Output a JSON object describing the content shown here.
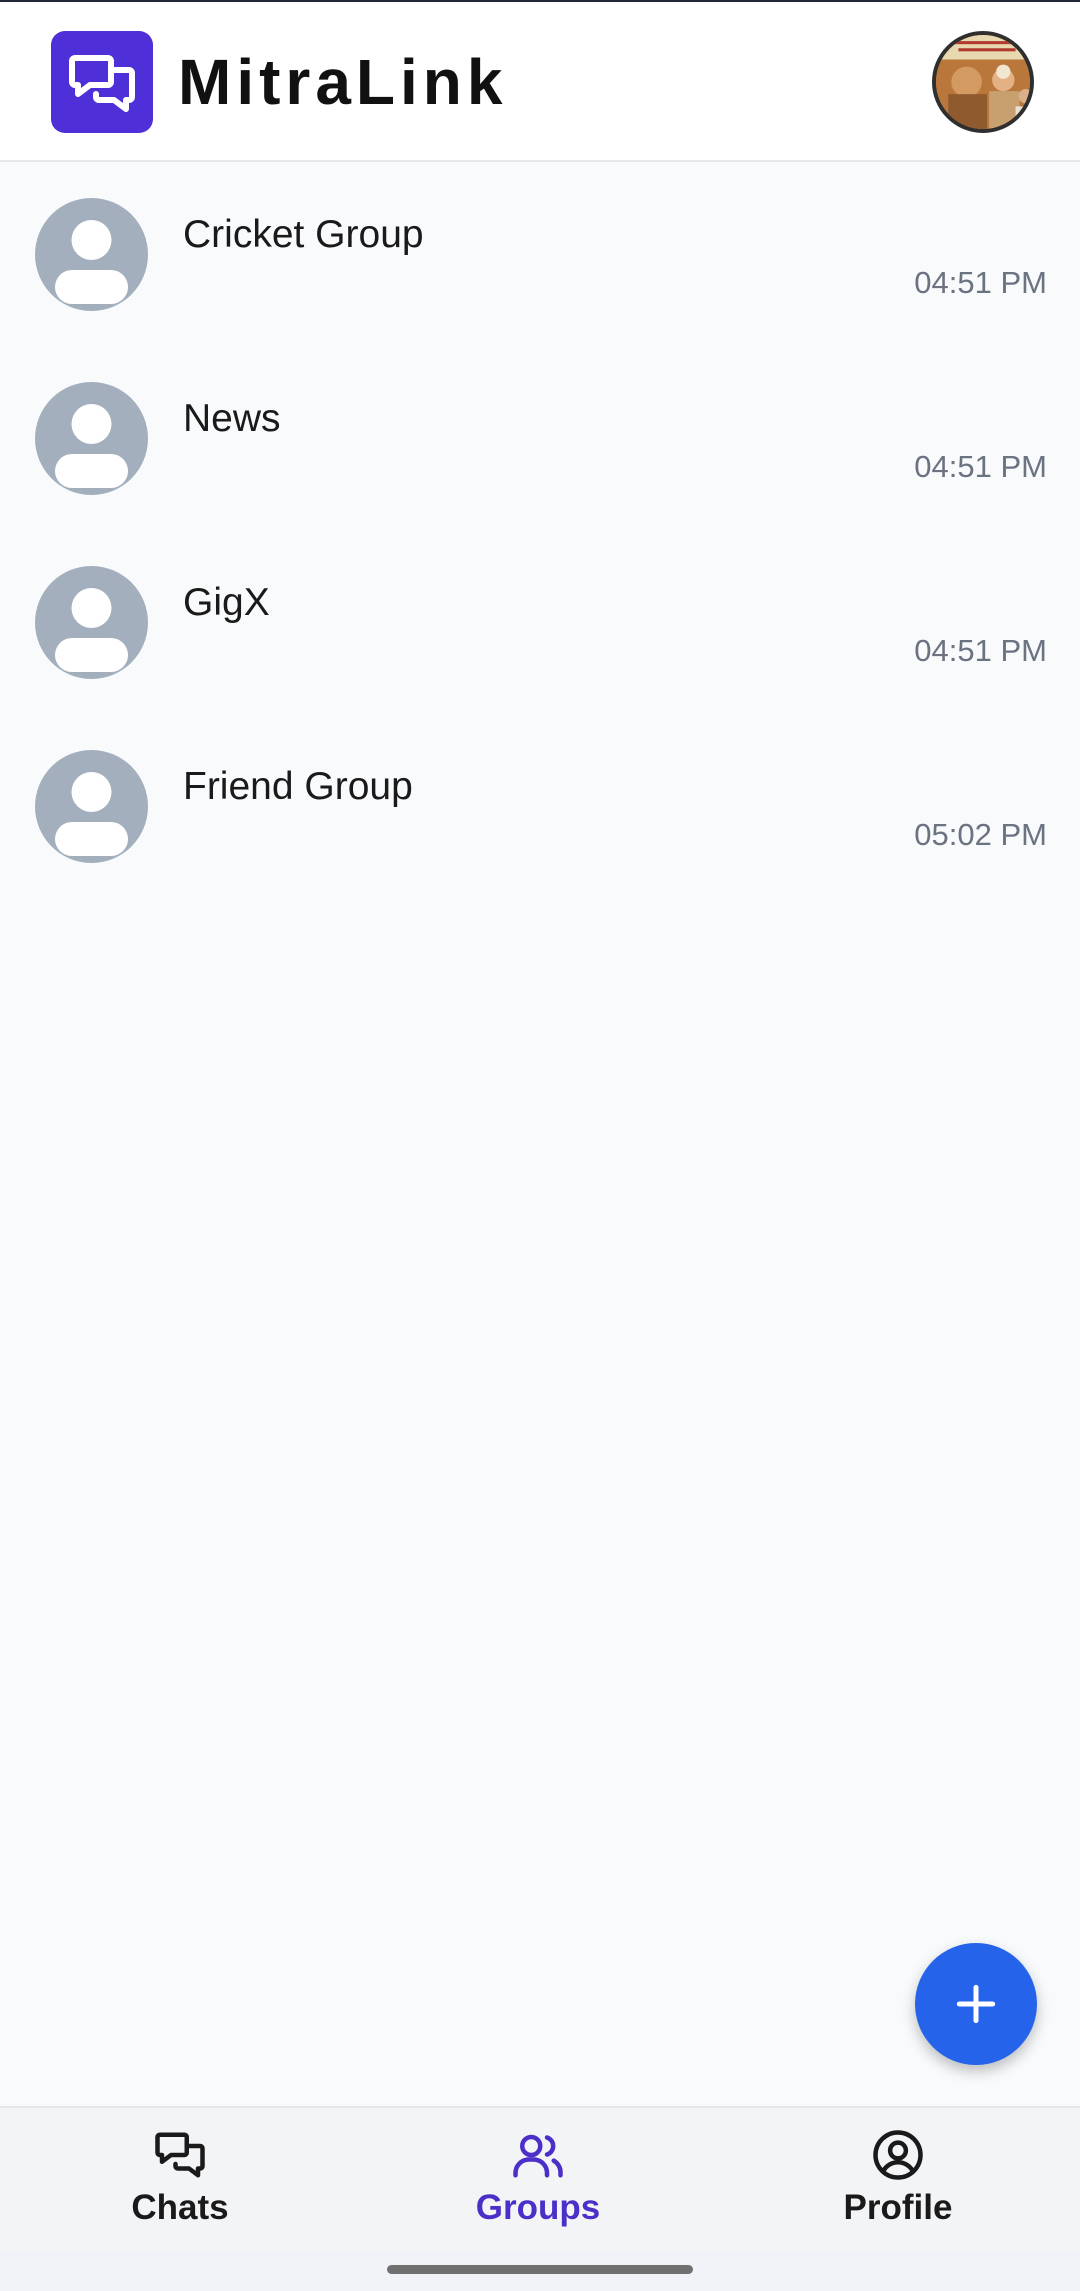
{
  "app": {
    "title": "MitraLink"
  },
  "header": {
    "logo_icon": "chat-bubbles-icon",
    "avatar_icon": "user-photo"
  },
  "groups": [
    {
      "name": "Cricket Group",
      "time": "04:51 PM"
    },
    {
      "name": "News",
      "time": "04:51 PM"
    },
    {
      "name": "GigX",
      "time": "04:51 PM"
    },
    {
      "name": "Friend Group",
      "time": "05:02 PM"
    }
  ],
  "fab": {
    "icon": "plus-icon"
  },
  "nav": {
    "active": "groups",
    "items": [
      {
        "key": "chats",
        "label": "Chats",
        "icon": "chats-icon"
      },
      {
        "key": "groups",
        "label": "Groups",
        "icon": "groups-icon"
      },
      {
        "key": "profile",
        "label": "Profile",
        "icon": "profile-icon"
      }
    ]
  },
  "colors": {
    "brand": "#4f2fd8",
    "fab": "#2563eb",
    "nav_active": "#4c2fc8",
    "nav_inactive": "#1a1a1a",
    "avatar_placeholder": "#a3afbd"
  }
}
